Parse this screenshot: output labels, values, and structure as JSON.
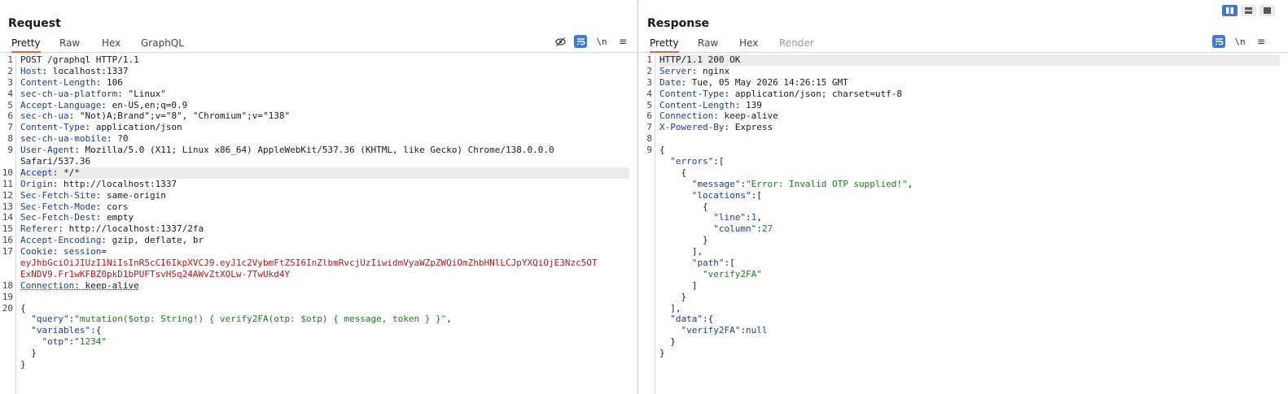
{
  "layout_switch": {
    "buttons": [
      {
        "name": "layout-side-by-side-icon",
        "glyph": "▮▮"
      },
      {
        "name": "layout-stacked-icon",
        "glyph": "☰"
      },
      {
        "name": "layout-single-icon",
        "glyph": "▬"
      }
    ]
  },
  "request": {
    "title": "Request",
    "tabs": [
      "Pretty",
      "Raw",
      "Hex",
      "GraphQL"
    ],
    "toolbar": {
      "hide_icon": "⊘",
      "wrap_icon": "⇥",
      "newline_label": "\\n",
      "menu_icon": "≡"
    },
    "lines": [
      {
        "n": "1",
        "segments": [
          {
            "t": "POST /graphql HTTP/1.1",
            "c": ""
          }
        ]
      },
      {
        "n": "2",
        "segments": [
          {
            "t": "Host",
            "c": "hk"
          },
          {
            "t": ": localhost:1337",
            "c": ""
          }
        ]
      },
      {
        "n": "3",
        "segments": [
          {
            "t": "Content-Length",
            "c": "hk"
          },
          {
            "t": ": 106",
            "c": ""
          }
        ]
      },
      {
        "n": "4",
        "segments": [
          {
            "t": "sec-ch-ua-platform",
            "c": "hk"
          },
          {
            "t": ": \"Linux\"",
            "c": ""
          }
        ]
      },
      {
        "n": "5",
        "segments": [
          {
            "t": "Accept-Language",
            "c": "hk"
          },
          {
            "t": ": en-US,en;q=0.9",
            "c": ""
          }
        ]
      },
      {
        "n": "6",
        "segments": [
          {
            "t": "sec-ch-ua",
            "c": "hk"
          },
          {
            "t": ": \"Not)A;Brand\";v=\"8\", \"Chromium\";v=\"138\"",
            "c": ""
          }
        ]
      },
      {
        "n": "7",
        "segments": [
          {
            "t": "Content-Type",
            "c": "hk"
          },
          {
            "t": ": application/json",
            "c": ""
          }
        ]
      },
      {
        "n": "8",
        "segments": [
          {
            "t": "sec-ch-ua-mobile",
            "c": "hk"
          },
          {
            "t": ": ?0",
            "c": ""
          }
        ]
      },
      {
        "n": "9",
        "segments": [
          {
            "t": "User-Agent",
            "c": "hk"
          },
          {
            "t": ": Mozilla/5.0 (X11; Linux x86_64) AppleWebKit/537.36 (KHTML, like Gecko) Chrome/138.0.0.0",
            "c": ""
          }
        ]
      },
      {
        "n": "",
        "segments": [
          {
            "t": "Safari/537.36",
            "c": ""
          }
        ]
      },
      {
        "n": "10",
        "hl": true,
        "segments": [
          {
            "t": "Accept",
            "c": "hk"
          },
          {
            "t": ": */*",
            "c": ""
          }
        ]
      },
      {
        "n": "11",
        "segments": [
          {
            "t": "Origin",
            "c": "hk"
          },
          {
            "t": ": http://localhost:1337",
            "c": ""
          }
        ]
      },
      {
        "n": "12",
        "segments": [
          {
            "t": "Sec-Fetch-Site",
            "c": "hk"
          },
          {
            "t": ": same-origin",
            "c": ""
          }
        ]
      },
      {
        "n": "13",
        "segments": [
          {
            "t": "Sec-Fetch-Mode",
            "c": "hk"
          },
          {
            "t": ": cors",
            "c": ""
          }
        ]
      },
      {
        "n": "14",
        "segments": [
          {
            "t": "Sec-Fetch-Dest",
            "c": "hk"
          },
          {
            "t": ": empty",
            "c": ""
          }
        ]
      },
      {
        "n": "15",
        "segments": [
          {
            "t": "Referer",
            "c": "hk"
          },
          {
            "t": ": http://localhost:1337/2fa",
            "c": ""
          }
        ]
      },
      {
        "n": "16",
        "segments": [
          {
            "t": "Accept-Encoding",
            "c": "hk"
          },
          {
            "t": ": gzip, deflate, br",
            "c": ""
          }
        ]
      },
      {
        "n": "17",
        "segments": [
          {
            "t": "Cookie",
            "c": "hk"
          },
          {
            "t": ": ",
            "c": ""
          },
          {
            "t": "session",
            "c": "hk"
          },
          {
            "t": "=",
            "c": ""
          }
        ]
      },
      {
        "n": "",
        "segments": [
          {
            "t": "eyJhbGciOiJIUzI1NiIsInR5cCI6IkpXVCJ9.eyJ1c2VybmFtZSI6InZlbmRvcjUzIiwidmVyaWZpZWQiOmZhbHNlLCJpYXQiOjE3Nzc5OT",
            "c": "ckv"
          }
        ]
      },
      {
        "n": "",
        "segments": [
          {
            "t": "ExNDV9.Fr1wKFBZ0pkD1bPUFTsvHSq24AWvZtXOLw-7TwUkd4Y",
            "c": "ckv"
          }
        ]
      },
      {
        "n": "18",
        "segments": [
          {
            "t": "Connection",
            "c": "hk conn"
          },
          {
            "t": ": keep-alive",
            "c": "conn"
          }
        ]
      },
      {
        "n": "19",
        "segments": [
          {
            "t": "",
            "c": ""
          }
        ]
      },
      {
        "n": "20",
        "segments": [
          {
            "t": "{",
            "c": ""
          }
        ]
      },
      {
        "n": "",
        "segments": [
          {
            "t": "  ",
            "c": ""
          },
          {
            "t": "\"query\"",
            "c": "jk"
          },
          {
            "t": ":",
            "c": ""
          },
          {
            "t": "\"mutation($otp: String!) { verify2FA(otp: $otp) { message, token } }\"",
            "c": "js"
          },
          {
            "t": ",",
            "c": ""
          }
        ]
      },
      {
        "n": "",
        "segments": [
          {
            "t": "  ",
            "c": ""
          },
          {
            "t": "\"variables\"",
            "c": "jk"
          },
          {
            "t": ":{",
            "c": ""
          }
        ]
      },
      {
        "n": "",
        "segments": [
          {
            "t": "    ",
            "c": ""
          },
          {
            "t": "\"otp\"",
            "c": "jk"
          },
          {
            "t": ":",
            "c": ""
          },
          {
            "t": "\"1234\"",
            "c": "js"
          }
        ]
      },
      {
        "n": "",
        "segments": [
          {
            "t": "  }",
            "c": ""
          }
        ]
      },
      {
        "n": "",
        "segments": [
          {
            "t": "}",
            "c": ""
          }
        ]
      }
    ]
  },
  "response": {
    "title": "Response",
    "tabs": [
      "Pretty",
      "Raw",
      "Hex",
      "Render"
    ],
    "toolbar": {
      "wrap_icon": "⇥",
      "newline_label": "\\n",
      "menu_icon": "≡"
    },
    "lines": [
      {
        "n": "1",
        "hl": true,
        "segments": [
          {
            "t": "HTTP/1.1 200 OK",
            "c": ""
          }
        ]
      },
      {
        "n": "2",
        "segments": [
          {
            "t": "Server",
            "c": "hk"
          },
          {
            "t": ": nginx",
            "c": ""
          }
        ]
      },
      {
        "n": "3",
        "segments": [
          {
            "t": "Date",
            "c": "hk"
          },
          {
            "t": ": Tue, 05 May 2026 14:26:15 GMT",
            "c": ""
          }
        ]
      },
      {
        "n": "4",
        "segments": [
          {
            "t": "Content-Type",
            "c": "hk"
          },
          {
            "t": ": application/json; charset=utf-8",
            "c": ""
          }
        ]
      },
      {
        "n": "5",
        "segments": [
          {
            "t": "Content-Length",
            "c": "hk"
          },
          {
            "t": ": 139",
            "c": ""
          }
        ]
      },
      {
        "n": "6",
        "segments": [
          {
            "t": "Connection",
            "c": "hk"
          },
          {
            "t": ": keep-alive",
            "c": ""
          }
        ]
      },
      {
        "n": "7",
        "segments": [
          {
            "t": "X-Powered-By",
            "c": "hk"
          },
          {
            "t": ": Express",
            "c": ""
          }
        ]
      },
      {
        "n": "8",
        "segments": [
          {
            "t": "",
            "c": ""
          }
        ]
      },
      {
        "n": "9",
        "segments": [
          {
            "t": "{",
            "c": ""
          }
        ]
      },
      {
        "n": "",
        "segments": [
          {
            "t": "  ",
            "c": ""
          },
          {
            "t": "\"errors\"",
            "c": "jk"
          },
          {
            "t": ":[",
            "c": ""
          }
        ]
      },
      {
        "n": "",
        "segments": [
          {
            "t": "    {",
            "c": ""
          }
        ]
      },
      {
        "n": "",
        "segments": [
          {
            "t": "      ",
            "c": ""
          },
          {
            "t": "\"message\"",
            "c": "jk"
          },
          {
            "t": ":",
            "c": ""
          },
          {
            "t": "\"Error: Invalid OTP supplied!\"",
            "c": "js"
          },
          {
            "t": ",",
            "c": ""
          }
        ]
      },
      {
        "n": "",
        "segments": [
          {
            "t": "      ",
            "c": ""
          },
          {
            "t": "\"locations\"",
            "c": "jk"
          },
          {
            "t": ":[",
            "c": ""
          }
        ]
      },
      {
        "n": "",
        "segments": [
          {
            "t": "        {",
            "c": ""
          }
        ]
      },
      {
        "n": "",
        "segments": [
          {
            "t": "          ",
            "c": ""
          },
          {
            "t": "\"line\"",
            "c": "jk"
          },
          {
            "t": ":",
            "c": ""
          },
          {
            "t": "1",
            "c": "jn"
          },
          {
            "t": ",",
            "c": ""
          }
        ]
      },
      {
        "n": "",
        "segments": [
          {
            "t": "          ",
            "c": ""
          },
          {
            "t": "\"column\"",
            "c": "jk"
          },
          {
            "t": ":",
            "c": ""
          },
          {
            "t": "27",
            "c": "jn"
          }
        ]
      },
      {
        "n": "",
        "segments": [
          {
            "t": "        }",
            "c": ""
          }
        ]
      },
      {
        "n": "",
        "segments": [
          {
            "t": "      ],",
            "c": ""
          }
        ]
      },
      {
        "n": "",
        "segments": [
          {
            "t": "      ",
            "c": ""
          },
          {
            "t": "\"path\"",
            "c": "jk"
          },
          {
            "t": ":[",
            "c": ""
          }
        ]
      },
      {
        "n": "",
        "segments": [
          {
            "t": "        ",
            "c": ""
          },
          {
            "t": "\"verify2FA\"",
            "c": "js"
          }
        ]
      },
      {
        "n": "",
        "segments": [
          {
            "t": "      ]",
            "c": ""
          }
        ]
      },
      {
        "n": "",
        "segments": [
          {
            "t": "    }",
            "c": ""
          }
        ]
      },
      {
        "n": "",
        "segments": [
          {
            "t": "  ],",
            "c": ""
          }
        ]
      },
      {
        "n": "",
        "segments": [
          {
            "t": "  ",
            "c": ""
          },
          {
            "t": "\"data\"",
            "c": "jk"
          },
          {
            "t": ":{",
            "c": ""
          }
        ]
      },
      {
        "n": "",
        "segments": [
          {
            "t": "    ",
            "c": ""
          },
          {
            "t": "\"verify2FA\"",
            "c": "jk"
          },
          {
            "t": ":",
            "c": ""
          },
          {
            "t": "null",
            "c": "jb"
          }
        ]
      },
      {
        "n": "",
        "segments": [
          {
            "t": "  }",
            "c": ""
          }
        ]
      },
      {
        "n": "",
        "segments": [
          {
            "t": "}",
            "c": ""
          }
        ]
      }
    ]
  }
}
